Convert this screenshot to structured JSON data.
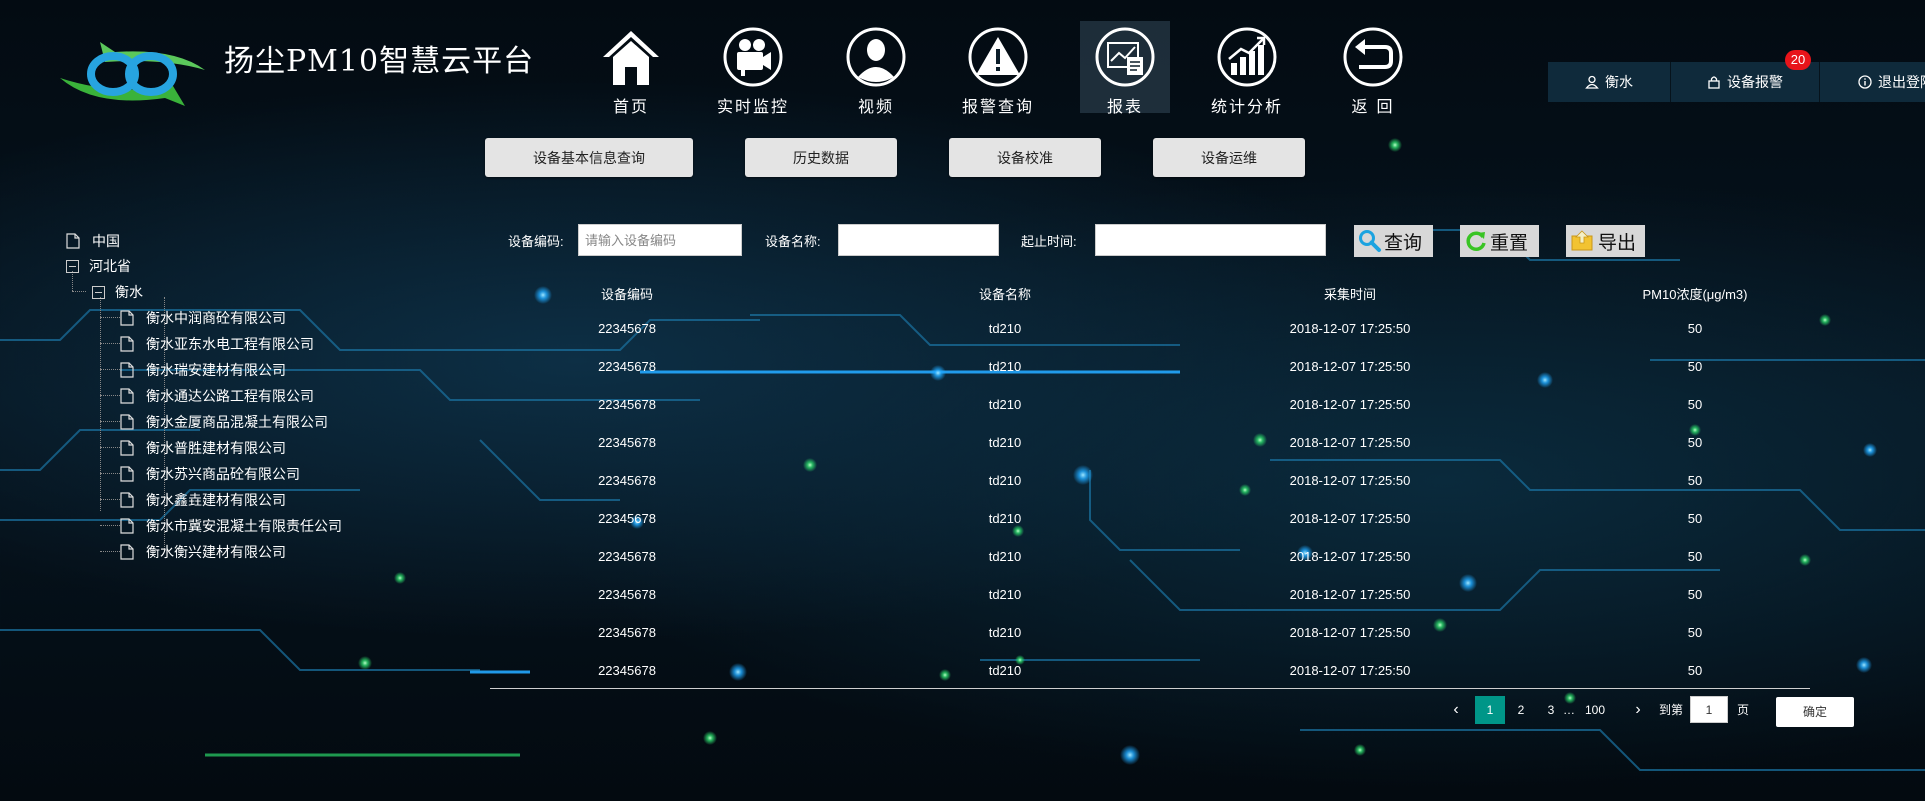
{
  "header": {
    "title": "扬尘PM10智慧云平台",
    "nav": [
      {
        "label": "首页",
        "icon": "home-icon"
      },
      {
        "label": "实时监控",
        "icon": "camera-icon"
      },
      {
        "label": "视频",
        "icon": "person-icon"
      },
      {
        "label": "报警查询",
        "icon": "alert-icon"
      },
      {
        "label": "报表",
        "icon": "report-icon",
        "active": true
      },
      {
        "label": "统计分析",
        "icon": "bar-chart-icon"
      },
      {
        "label": "返 回",
        "icon": "return-icon"
      }
    ],
    "user": "衡水",
    "device_alarm": "设备报警",
    "alarm_count": "20",
    "logout": "退出登陆"
  },
  "subtabs": [
    "设备基本信息查询",
    "历史数据",
    "设备校准",
    "设备运维"
  ],
  "tree": {
    "root": "中国",
    "province": "河北省",
    "city": "衡水",
    "companies": [
      "衡水中润商砼有限公司",
      "衡水亚东水电工程有限公司",
      "衡水瑞安建材有限公司",
      "衡水通达公路工程有限公司",
      "衡水金厦商品混凝土有限公司",
      "衡水普胜建材有限公司",
      "衡水苏兴商品砼有限公司",
      "衡水鑫垚建材有限公司",
      "衡水市冀安混凝土有限责任公司",
      "衡水衡兴建材有限公司"
    ]
  },
  "search": {
    "code_label": "设备编码:",
    "code_placeholder": "请输入设备编码",
    "code_value": "",
    "name_label": "设备名称:",
    "name_value": "",
    "time_label": "起止时间:",
    "time_value": "",
    "query": "查询",
    "reset": "重置",
    "export": "导出"
  },
  "table": {
    "columns": [
      "设备编码",
      "设备名称",
      "采集时间",
      "PM10浓度(μg/m3)"
    ],
    "rows": [
      [
        "22345678",
        "td210",
        "2018-12-07 17:25:50",
        "50"
      ],
      [
        "22345678",
        "td210",
        "2018-12-07 17:25:50",
        "50"
      ],
      [
        "22345678",
        "td210",
        "2018-12-07 17:25:50",
        "50"
      ],
      [
        "22345678",
        "td210",
        "2018-12-07 17:25:50",
        "50"
      ],
      [
        "22345678",
        "td210",
        "2018-12-07 17:25:50",
        "50"
      ],
      [
        "22345678",
        "td210",
        "2018-12-07 17:25:50",
        "50"
      ],
      [
        "22345678",
        "td210",
        "2018-12-07 17:25:50",
        "50"
      ],
      [
        "22345678",
        "td210",
        "2018-12-07 17:25:50",
        "50"
      ],
      [
        "22345678",
        "td210",
        "2018-12-07 17:25:50",
        "50"
      ],
      [
        "22345678",
        "td210",
        "2018-12-07 17:25:50",
        "50"
      ]
    ]
  },
  "pager": {
    "current": "1",
    "p2": "2",
    "p3": "3",
    "ellipsis": "…",
    "last": "100",
    "goto_label": "到第",
    "goto_value": "1",
    "page_unit": "页",
    "confirm": "确定"
  },
  "colors": {
    "accent": "#009688",
    "badge": "#e8141a",
    "glow": "#1fa9ff"
  }
}
